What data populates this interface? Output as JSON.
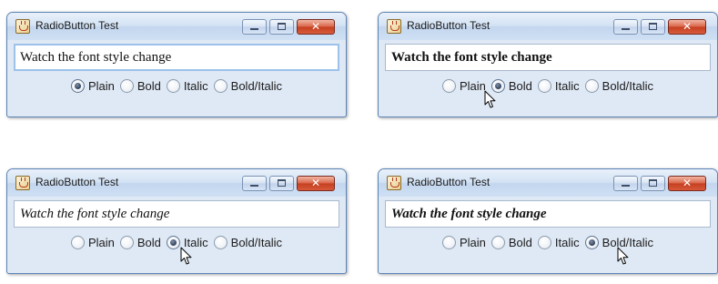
{
  "windows": [
    {
      "title": "RadioButton Test",
      "text": "Watch the font style change",
      "selected": 0,
      "style": "plain",
      "focused": true
    },
    {
      "title": "RadioButton Test",
      "text": "Watch the font style change",
      "selected": 1,
      "style": "bold",
      "focused": false
    },
    {
      "title": "RadioButton Test",
      "text": "Watch the font style change",
      "selected": 2,
      "style": "italic",
      "focused": false
    },
    {
      "title": "RadioButton Test",
      "text": "Watch the font style change",
      "selected": 3,
      "style": "bolditalic",
      "focused": false
    }
  ],
  "radio_options": [
    "Plain",
    "Bold",
    "Italic",
    "Bold/Italic"
  ],
  "icons": {
    "app": "java-cup-icon",
    "cursor": "mouse-pointer-icon"
  },
  "colors": {
    "accent": "#dfe9f5",
    "close_button": "#c4401f",
    "focus_border": "#9cc2ea"
  }
}
